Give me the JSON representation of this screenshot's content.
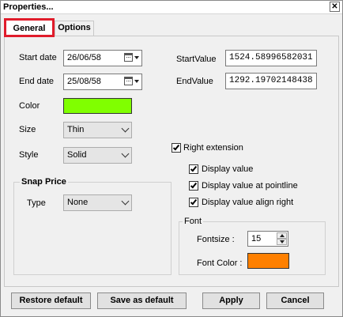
{
  "window": {
    "title": "Properties...",
    "close_glyph": "✕"
  },
  "tabs": [
    {
      "label": "General",
      "active": true
    },
    {
      "label": "Options",
      "active": false
    }
  ],
  "general": {
    "start_date_label": "Start date",
    "start_date_value": "26/06/58",
    "end_date_label": "End date",
    "end_date_value": "25/08/58",
    "start_value_label": "StartValue",
    "start_value": "1524.58996582031",
    "end_value_label": "EndValue",
    "end_value": "1292.19702148438",
    "color_label": "Color",
    "color_value": "#80ff00",
    "size_label": "Size",
    "size_value": "Thin",
    "style_label": "Style",
    "style_value": "Solid",
    "right_extension_label": "Right extension",
    "right_extension_checked": true,
    "display_value_label": "Display value",
    "display_value_checked": true,
    "display_value_pointline_label": "Display value at pointline",
    "display_value_pointline_checked": true,
    "display_value_align_right_label": "Display value align right",
    "display_value_align_right_checked": true,
    "snap_price_title": "Snap Price",
    "type_label": "Type",
    "type_value": "None",
    "font_title": "Font",
    "fontsize_label": "Fontsize :",
    "fontsize_value": "15",
    "font_color_label": "Font Color :",
    "font_color_value": "#ff8000"
  },
  "buttons": {
    "restore_default": "Restore default",
    "save_as_default": "Save as default",
    "apply": "Apply",
    "cancel": "Cancel"
  },
  "icons": {
    "calendar": "calendar-icon",
    "dropdown": "chevron-down-icon",
    "close": "close-icon"
  }
}
